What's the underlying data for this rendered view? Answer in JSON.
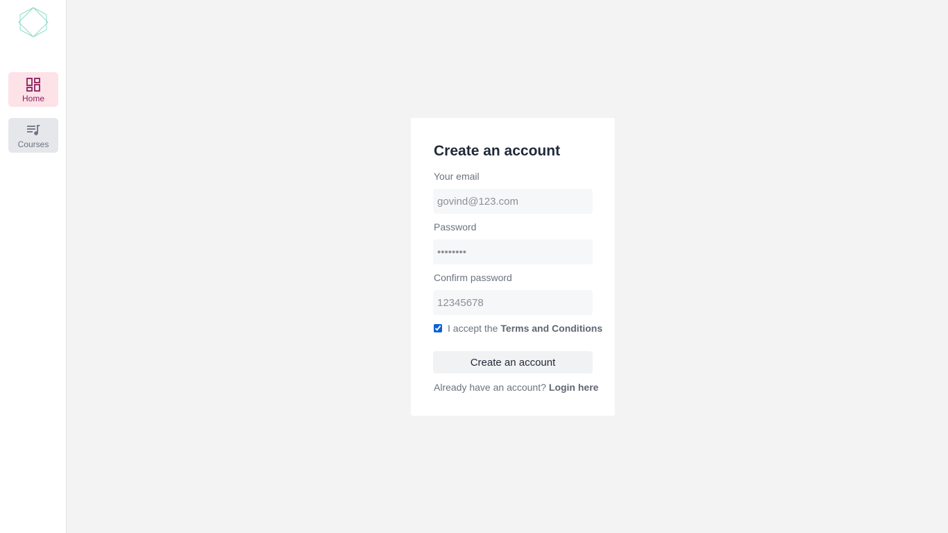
{
  "sidebar": {
    "logo": {
      "icon": "hexagon-logo-icon",
      "color": "#8fd9c8"
    },
    "items": [
      {
        "label": "Home",
        "icon": "dashboard-icon",
        "active": true,
        "accent": "#8b1f5a",
        "bg": "#fde2e8"
      },
      {
        "label": "Courses",
        "icon": "playlist-music-icon",
        "active": false,
        "accent": "#6b7280",
        "bg": "#e5e7eb"
      }
    ]
  },
  "form": {
    "title": "Create an account",
    "email": {
      "label": "Your email",
      "value": "govind@123.com"
    },
    "password": {
      "label": "Password",
      "value": "12345678"
    },
    "confirm": {
      "label": "Confirm password",
      "value": "12345678"
    },
    "terms": {
      "prefix": "I accept the",
      "link": "Terms and Conditions",
      "checked": true
    },
    "submit_label": "Create an account",
    "login": {
      "prefix": "Already have an account?",
      "link": "Login here"
    }
  },
  "colors": {
    "background": "#f3f3f3",
    "card": "#ffffff",
    "checkbox": "#0b61d8"
  }
}
